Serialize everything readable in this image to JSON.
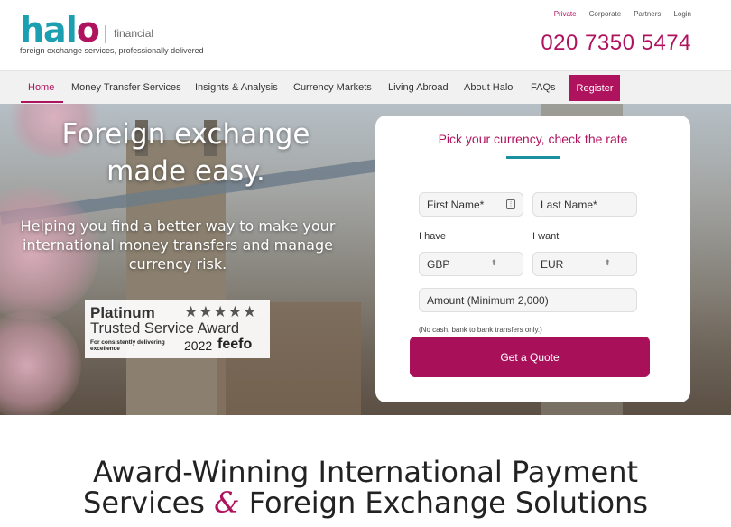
{
  "brand": {
    "name_h": "hal",
    "name_o": "o",
    "sub": "financial",
    "tagline": "foreign exchange services, professionally delivered"
  },
  "top_links": [
    "Private",
    "Corporate",
    "Partners",
    "Login"
  ],
  "phone": "020 7350 5474",
  "nav": {
    "items": [
      "Home",
      "Money Transfer Services",
      "Insights & Analysis",
      "Currency Markets",
      "Living Abroad",
      "About Halo",
      "FAQs"
    ],
    "register": "Register"
  },
  "hero": {
    "title": "Foreign exchange made easy.",
    "subtitle": "Helping you find a better way to make your international money transfers and manage currency risk."
  },
  "award": {
    "platinum": "Platinum",
    "stars": "★★★★★",
    "title": "Trusted Service Award",
    "small": "For consistently delivering excellence",
    "year": "2022",
    "brand": "feefo"
  },
  "form": {
    "title": "Pick your currency, check the rate",
    "first_name": "First Name*",
    "last_name": "Last Name*",
    "have_label": "I have",
    "want_label": "I want",
    "have_value": "GBP",
    "want_value": "EUR",
    "amount": "Amount (Minimum 2,000)",
    "note": "(No cash, bank to bank transfers only.)",
    "button": "Get a Quote"
  },
  "section": {
    "line1": "Award-Winning International Payment",
    "line2a": "Services",
    "amp": "&",
    "line2b": "Foreign Exchange Solutions"
  },
  "colors": {
    "brand_magenta": "#b0135e",
    "brand_teal": "#1c9fb0"
  }
}
